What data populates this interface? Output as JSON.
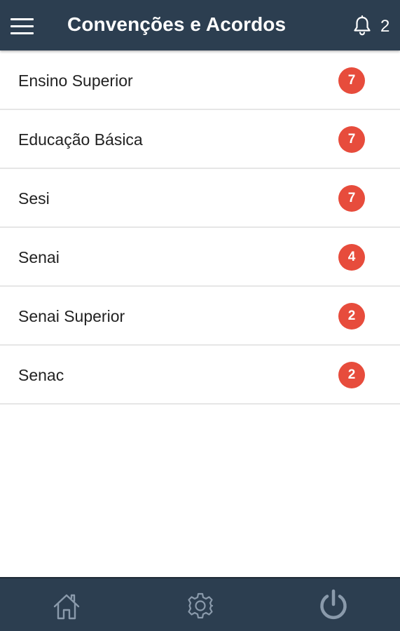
{
  "header": {
    "title": "Convenções e Acordos",
    "menu_icon": "hamburger-menu-icon",
    "notification_icon": "bell-icon",
    "notification_count": "2"
  },
  "list": {
    "items": [
      {
        "label": "Ensino Superior",
        "count": "7"
      },
      {
        "label": "Educação Básica",
        "count": "7"
      },
      {
        "label": "Sesi",
        "count": "7"
      },
      {
        "label": "Senai",
        "count": "4"
      },
      {
        "label": "Senai Superior",
        "count": "2"
      },
      {
        "label": "Senac",
        "count": "2"
      }
    ]
  },
  "bottom_nav": {
    "items": [
      {
        "icon": "home-icon"
      },
      {
        "icon": "gear-icon"
      },
      {
        "icon": "power-icon"
      }
    ]
  },
  "colors": {
    "app_bar": "#2c3e50",
    "badge": "#e74c3c",
    "icon_muted": "#8a9aab"
  }
}
